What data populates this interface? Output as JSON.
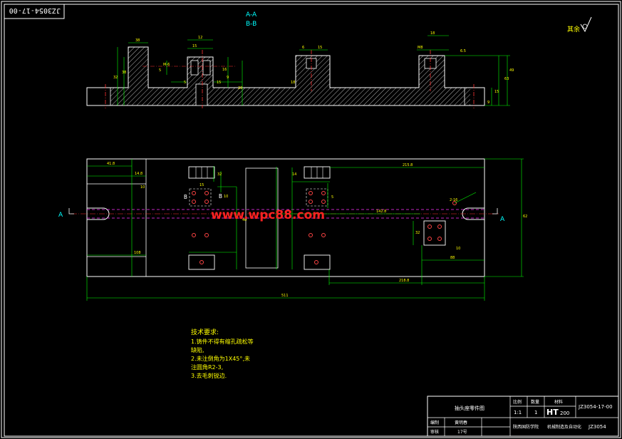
{
  "frame": {
    "stamp": "JZ3054-17-00"
  },
  "section_labels": {
    "aa": "A-A",
    "bb": "B-B"
  },
  "roughness": {
    "label": "其余"
  },
  "dims_top": [
    "38",
    "12",
    "15",
    "M-6",
    "32",
    "38",
    "5",
    "16",
    "9",
    "5",
    "15",
    "20",
    "18",
    "6",
    "15",
    "18",
    "M8",
    "6.5",
    "63",
    "15",
    "9",
    "49"
  ],
  "dims_plan": {
    "d1": "41.8",
    "d2": "14.8",
    "d3": "10",
    "d4": "32",
    "d5": "215.8",
    "d6": "10",
    "d7": "2-16",
    "d8": "15",
    "d9": "40",
    "d10": "14",
    "d11": "5",
    "d12": "142.8",
    "d13": "32",
    "d14": "10",
    "d15": "108",
    "d16": "88",
    "d17": "218.8",
    "d18": "511",
    "d19": "62"
  },
  "view_markers": {
    "left_a": "A",
    "right_a": "A",
    "b1": "B",
    "b2": "B"
  },
  "watermark": "www.wpc88.com",
  "notes": {
    "heading": "技术要求:",
    "line1": "1.铸件不得有缩孔疏松等",
    "line2": "缺陷,",
    "line3": "2.未注倒角为1X45°,未",
    "line4": "注圆角R2-3,",
    "line5": "3.去毛刺锐边."
  },
  "title_block": {
    "drawing_name": "抽头座零件图",
    "scale_label": "比例",
    "qty_label": "数量",
    "material_label": "材料",
    "scale": "1:1",
    "qty": "1",
    "material_ht": "HT",
    "material_grade": "200",
    "code": "JZ3054-17-00",
    "drafter_label": "编制",
    "drafter": "黄明春",
    "school": "陕西国防学院",
    "course": "机械制造及自动化",
    "project": "JZ3054",
    "checker_label": "审核",
    "number": "17号"
  }
}
